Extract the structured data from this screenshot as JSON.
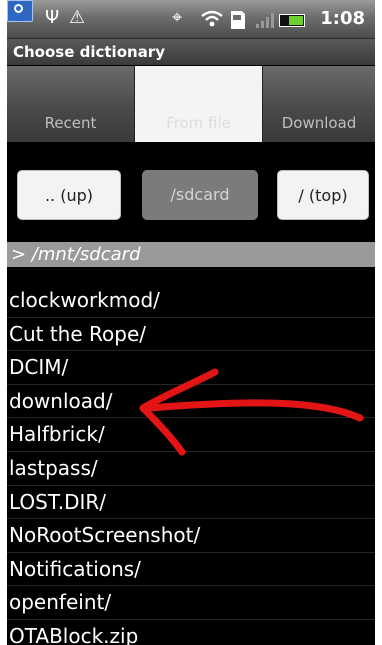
{
  "status_bar": {
    "time": "1:08",
    "colors": {
      "battery": "#6ccf2e",
      "photo_icon": "#2e67c2"
    },
    "icons": [
      "photo-notification-icon",
      "usb-icon",
      "warning-icon",
      "gps-icon",
      "wifi-icon",
      "sd-card-icon",
      "signal-icon",
      "battery-icon"
    ]
  },
  "title": "Choose dictionary",
  "tabs": [
    {
      "label": "Recent",
      "active": false
    },
    {
      "label": "From file",
      "active": true
    },
    {
      "label": "Download",
      "active": false
    }
  ],
  "path_buttons": {
    "up": ".. (up)",
    "sdcard": "/sdcard",
    "top": "/ (top)"
  },
  "current_path": "> /mnt/sdcard",
  "folders": [
    "clockworkmod/",
    "Cut the Rope/",
    "DCIM/",
    "download/",
    "Halfbrick/",
    "lastpass/",
    "LOST.DIR/",
    "NoRootScreenshot/",
    "Notifications/",
    "openfeint/",
    "OTABlock.zip"
  ],
  "annotation": {
    "type": "arrow",
    "points_to": "download/",
    "color": "#e31414"
  }
}
